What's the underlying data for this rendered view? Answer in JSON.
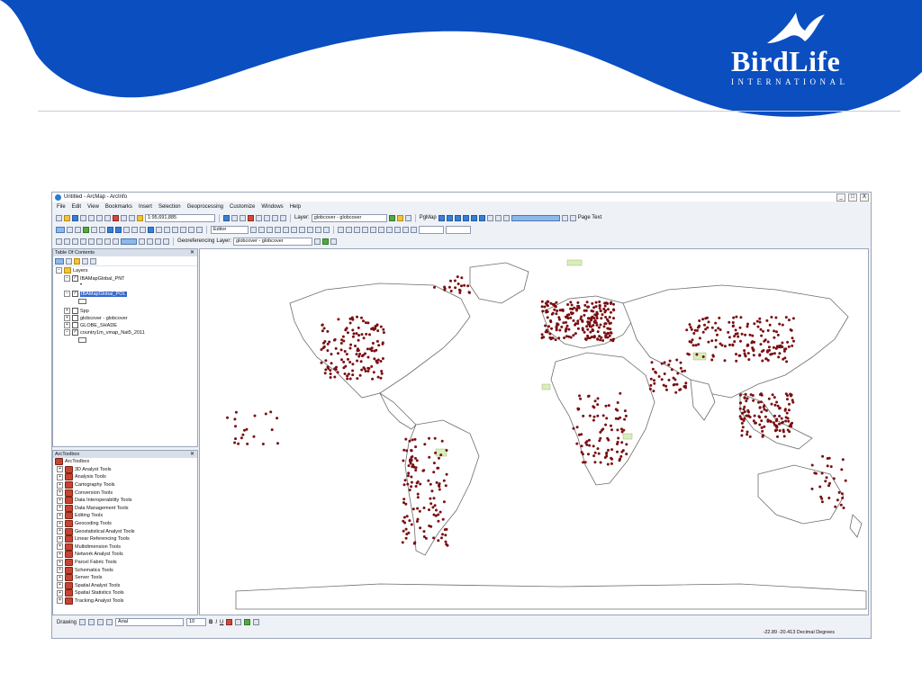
{
  "branding": {
    "logo_text": "BirdLife",
    "logo_subtext": "INTERNATIONAL",
    "colors": {
      "banner_blue": "#0a4ec0",
      "white": "#ffffff"
    }
  },
  "window": {
    "title": "Untitled - ArcMap - ArcInfo",
    "controls": [
      "_",
      "□",
      "X"
    ]
  },
  "menu": [
    "File",
    "Edit",
    "View",
    "Bookmarks",
    "Insert",
    "Selection",
    "Geoprocessing",
    "Customize",
    "Windows",
    "Help"
  ],
  "toolbar": {
    "scale": "1:95,691,885",
    "layer_label": "Layer:",
    "layer_value": "globcover - globcover",
    "pgmap_label": "PgMap",
    "page_text_label": "Page Text",
    "editor_label": "Editor",
    "georeferencing_label": "Georeferencing",
    "georef_layer_label": "Layer:",
    "georef_layer_value": "globcover - globcover"
  },
  "toc": {
    "title": "Table Of Contents",
    "root": "Layers",
    "layers": [
      {
        "name": "IBAMapGlobal_PNT",
        "checked": true
      },
      {
        "name": "IBAMapGlobal_POL",
        "checked": true,
        "selected": true
      },
      {
        "name": "Spp",
        "checked": false
      },
      {
        "name": "globcover - globcover",
        "checked": false
      },
      {
        "name": "GLOBE_SHADE",
        "checked": false
      },
      {
        "name": "country1m_vmap_Nat5_2011",
        "checked": true
      }
    ]
  },
  "toolbox": {
    "title": "ArcToolbox",
    "root": "ArcToolbox",
    "items": [
      "3D Analyst Tools",
      "Analysis Tools",
      "Cartography Tools",
      "Conversion Tools",
      "Data Interoperability Tools",
      "Data Management Tools",
      "Editing Tools",
      "Geocoding Tools",
      "Geostatistical Analyst Tools",
      "Linear Referencing Tools",
      "Multidimension Tools",
      "Network Analyst Tools",
      "Parcel Fabric Tools",
      "Schematics Tools",
      "Server Tools",
      "Spatial Analyst Tools",
      "Spatial Statistics Tools",
      "Tracking Analyst Tools"
    ]
  },
  "drawing": {
    "label": "Drawing",
    "font": "Arial",
    "font_size": "10",
    "bold": "B",
    "italic": "I",
    "underline": "U"
  },
  "status": {
    "coordinates": "-22.89  -20.413 Decimal Degrees"
  },
  "map": {
    "point_color": "#7a0f12",
    "polygon_fill": "#d9efb9"
  }
}
